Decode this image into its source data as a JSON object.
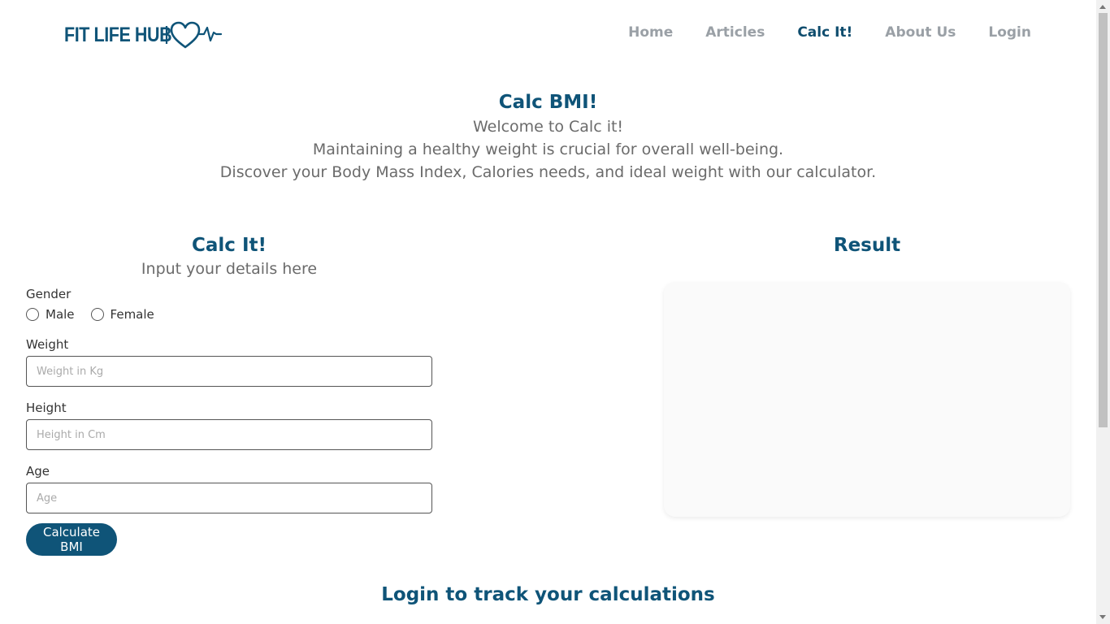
{
  "header": {
    "logo_text": "FIT LIFE HUB",
    "nav": [
      {
        "label": "Home",
        "active": false
      },
      {
        "label": "Articles",
        "active": false
      },
      {
        "label": "Calc It!",
        "active": true
      },
      {
        "label": "About Us",
        "active": false
      },
      {
        "label": "Login",
        "active": false
      }
    ]
  },
  "hero": {
    "title": "Calc BMI!",
    "lines": [
      "Welcome to Calc it!",
      "Maintaining a healthy weight is crucial for overall well-being.",
      "Discover your Body Mass Index, Calories needs, and ideal weight with our calculator."
    ]
  },
  "form": {
    "title": "Calc It!",
    "subtitle": "Input your details here",
    "gender_label": "Gender",
    "gender_options": [
      "Male",
      "Female"
    ],
    "weight_label": "Weight",
    "weight_placeholder": "Weight in Kg",
    "height_label": "Height",
    "height_placeholder": "Height in Cm",
    "age_label": "Age",
    "age_placeholder": "Age",
    "submit_label": "Calculate BMI"
  },
  "result": {
    "title": "Result"
  },
  "footer": {
    "track_text": "Login to track your calculations"
  },
  "colors": {
    "brand": "#0f5478",
    "nav_inactive": "#9aa0a6",
    "nav_active": "#0f4d6e",
    "result_bg": "#fafafa"
  },
  "icons": {
    "logo_mark": "heart-pulse-icon"
  }
}
